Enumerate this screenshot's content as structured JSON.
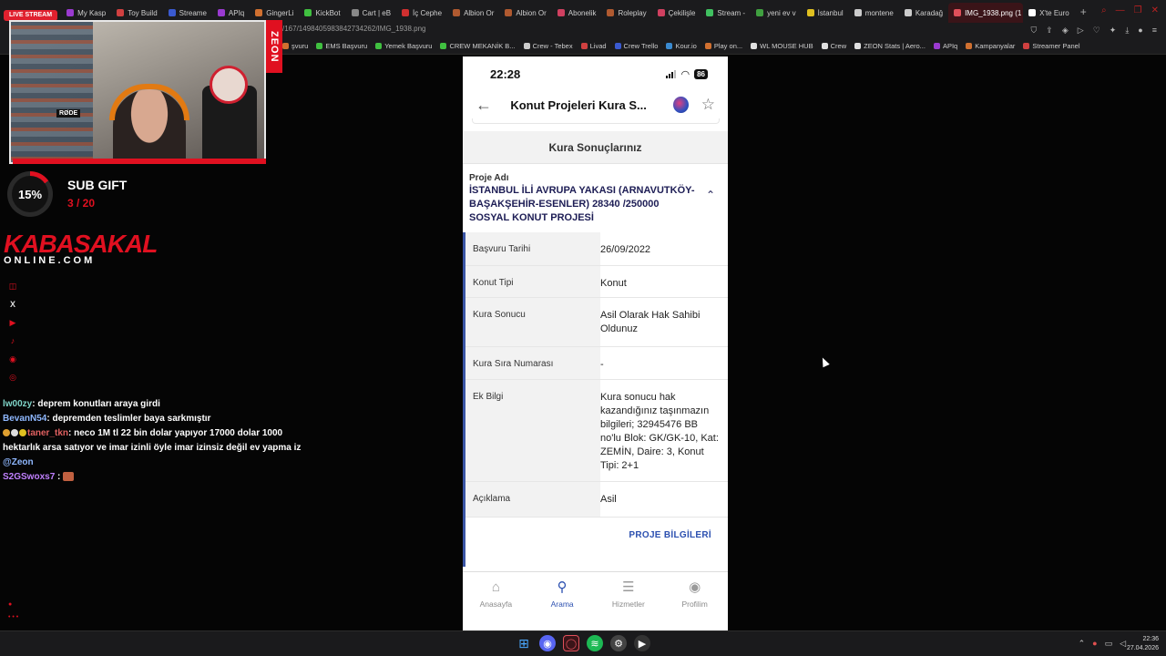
{
  "browser": {
    "tabs": [
      {
        "label": "LIVE STREAM",
        "type": "live",
        "color": "#e0202e"
      },
      {
        "label": "My Kasp",
        "color": "#9a3ad0"
      },
      {
        "label": "Toy Build",
        "color": "#d04040"
      },
      {
        "label": "Streame",
        "color": "#3a5ad0"
      },
      {
        "label": "APIq",
        "color": "#9a3ad0"
      },
      {
        "label": "GingerLi",
        "color": "#d07030"
      },
      {
        "label": "KickBot",
        "color": "#40c040"
      },
      {
        "label": "Cart | eB",
        "color": "#888888"
      },
      {
        "label": "İç Cephe",
        "color": "#d03030"
      },
      {
        "label": "Albion Or",
        "color": "#b05a30"
      },
      {
        "label": "Albion Or",
        "color": "#b05a30"
      },
      {
        "label": "Abonelik",
        "color": "#d04060"
      },
      {
        "label": "Roleplay",
        "color": "#b05a30"
      },
      {
        "label": "Çekilişle",
        "color": "#d04060"
      },
      {
        "label": "Stream -",
        "color": "#40c060"
      },
      {
        "label": "yeni ev v",
        "color": "#40a040"
      },
      {
        "label": "İstanbul",
        "color": "#e0c020"
      },
      {
        "label": "montene",
        "color": "#cccccc"
      },
      {
        "label": "Karadağ",
        "color": "#cccccc"
      },
      {
        "label": "IMG_1938.png (1",
        "type": "active",
        "color": "#e0505a"
      },
      {
        "label": "X'te Euro",
        "color": "#ffffff"
      }
    ],
    "new_tab": "+",
    "url": "/167/1498405983842734262/IMG_1938.png",
    "bookmarks": [
      {
        "label": "şvuru",
        "color": "#d07030"
      },
      {
        "label": "EMS Başvuru",
        "color": "#40c040"
      },
      {
        "label": "Yemek Başvuru",
        "color": "#40c040"
      },
      {
        "label": "CREW MEKANİK B...",
        "color": "#40c040"
      },
      {
        "label": "Crew - Tebex",
        "color": "#cccccc"
      },
      {
        "label": "Livad",
        "color": "#d04040"
      },
      {
        "label": "Crew Trello",
        "color": "#3a5ad0"
      },
      {
        "label": "Kour.io",
        "color": "#3a8ad0"
      },
      {
        "label": "Play on...",
        "color": "#d07030"
      },
      {
        "label": "WL MOUSE HUB",
        "color": "#e0e0e0"
      },
      {
        "label": "Crew",
        "color": "#e0e0e0"
      },
      {
        "label": "ZEON Stats | Aero...",
        "color": "#e0e0e0"
      },
      {
        "label": "APIq",
        "color": "#9a3ad0"
      },
      {
        "label": "Kampanyalar",
        "color": "#d07030"
      },
      {
        "label": "Streamer Panel",
        "color": "#d04040"
      }
    ]
  },
  "overlay": {
    "zeon_label": "ZEON",
    "sub_goal_percent": "15%",
    "sub_goal_fraction": 0.15,
    "sub_title": "SUB GIFT",
    "sub_count": "3 / 20",
    "brand_main": "KABASAKAL",
    "brand_sub": "ONLINE.COM",
    "webcam_mic_label": "RØDE",
    "chat": [
      {
        "user": "lw00zy",
        "text": ": deprem konutları araya girdi",
        "color": "#7fd4c8"
      },
      {
        "user": "BevanN54",
        "text": ": depremden teslimler baya sarkmıştır",
        "color": "#8fb8ff"
      },
      {
        "user": "taner_tkn",
        "text": ": neco 1M tl 22 bin dolar yapıyor 17000 dolar 1000 hektarlık arsa satıyor ve imar izinli öyle imar izinsiz değil ev yapma iz",
        "mention": "@Zeon",
        "color": "#e06060"
      },
      {
        "user": "S2GSwoxs7",
        "text": " : ",
        "color": "#c080ff"
      }
    ]
  },
  "phone": {
    "status": {
      "time": "22:28",
      "battery": "86"
    },
    "nav": {
      "title": "Konut Projeleri Kura S..."
    },
    "section_title": "Kura Sonuçlarınız",
    "project": {
      "label": "Proje Adı",
      "name": "İSTANBUL İLİ AVRUPA YAKASI (ARNAVUTKÖY-BAŞAKŞEHİR-ESENLER) 28340 /250000 SOSYAL KONUT PROJESİ"
    },
    "rows": [
      {
        "key": "Başvuru Tarihi",
        "value": "26/09/2022"
      },
      {
        "key": "Konut Tipi",
        "value": "Konut"
      },
      {
        "key": "Kura Sonucu",
        "value": "Asil Olarak Hak Sahibi Oldunuz"
      },
      {
        "key": "Kura Sıra Numarası",
        "value": "-"
      },
      {
        "key": "Ek Bilgi",
        "value": "Kura sonucu hak kazandığınız taşınmazın bilgileri; 32945476 BB no'lu Blok: GK/GK-10, Kat: ZEMİN, Daire: 3, Konut Tipi: 2+1"
      },
      {
        "key": "Açıklama",
        "value": "Asil"
      }
    ],
    "project_button": "PROJE BİLGİLERİ",
    "tabs": [
      {
        "label": "Anasayfa",
        "icon": "home-icon"
      },
      {
        "label": "Arama",
        "icon": "search-icon"
      },
      {
        "label": "Hizmetler",
        "icon": "list-icon"
      },
      {
        "label": "Profilim",
        "icon": "user-icon"
      }
    ]
  },
  "taskbar": {
    "time": "22:36",
    "date": "27.04.2026"
  }
}
